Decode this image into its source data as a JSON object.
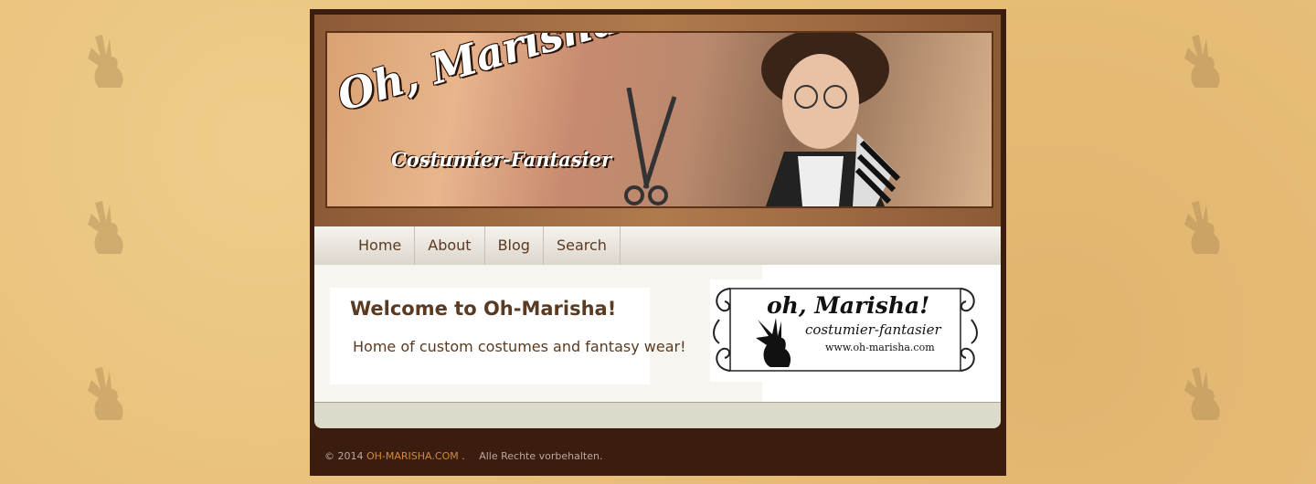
{
  "header": {
    "site_title": "Oh, Marisha!",
    "tagline": "Costumier-Fantasier"
  },
  "nav": {
    "items": [
      {
        "label": "Home"
      },
      {
        "label": "About"
      },
      {
        "label": "Blog"
      },
      {
        "label": "Search"
      }
    ]
  },
  "main": {
    "welcome_title": "Welcome to Oh-Marisha!",
    "welcome_text": "Home of custom costumes and fantasy wear!"
  },
  "logo": {
    "title": "oh, Marisha!",
    "subtitle": "costumier-fantasier",
    "url": "www.oh-marisha.com"
  },
  "footer": {
    "copyright": "© 2014",
    "site_link": "OH-MARISHA.COM",
    "separator": ".",
    "rights": "Alle Rechte vorbehalten."
  },
  "colors": {
    "background": "#e8bf7a",
    "frame": "#3b1d10",
    "nav_text": "#5a3a20",
    "link": "#d08a3a"
  }
}
